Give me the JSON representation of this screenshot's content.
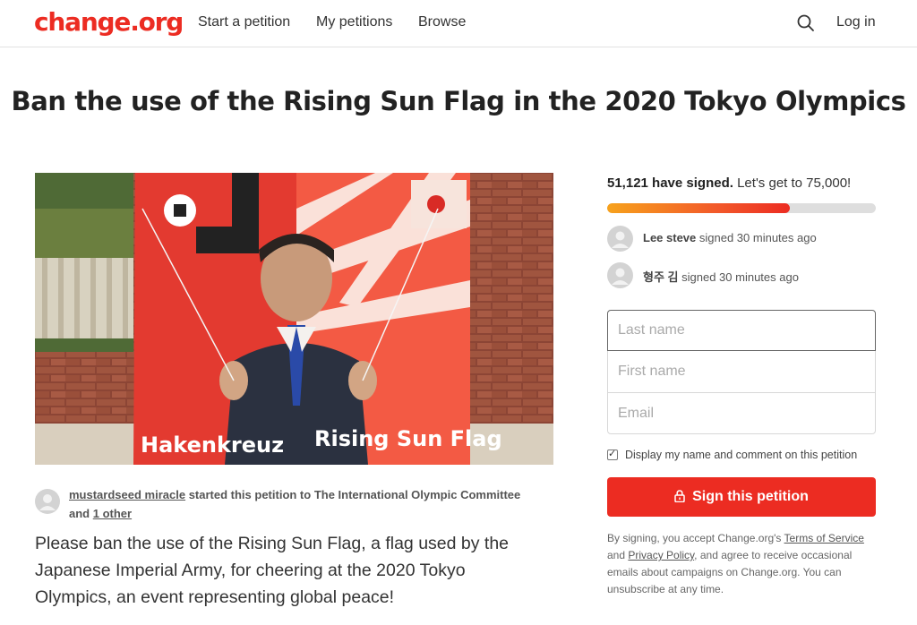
{
  "header": {
    "logo": "change.org",
    "nav": [
      "Start a petition",
      "My petitions",
      "Browse"
    ],
    "login": "Log in"
  },
  "petition": {
    "title": "Ban the use of the Rising Sun Flag in the 2020 Tokyo Olympics",
    "image_caption_left": "Hakenkreuz",
    "image_caption_right": "Rising Sun Flag",
    "starter_name": "mustardseed miracle",
    "starter_text": "started this petition to",
    "recipient": "The International Olympic Committee",
    "and_text": "and",
    "other_recipients": "1 other",
    "description": "Please ban the use of the Rising Sun Flag, a flag used by the Japanese Imperial Army, for cheering at the 2020 Tokyo Olympics, an event representing global peace!"
  },
  "signatures": {
    "count_text": "51,121 have signed.",
    "goal_text": "Let's get to 75,000!",
    "progress_fraction": 0.6816,
    "recent": [
      {
        "name": "Lee steve",
        "action": "signed 30 minutes ago"
      },
      {
        "name": "형주 김",
        "action": "signed 30 minutes ago"
      }
    ]
  },
  "form": {
    "last_name_placeholder": "Last name",
    "first_name_placeholder": "First name",
    "email_placeholder": "Email",
    "display_checkbox_checked": true,
    "display_checkbox_label": "Display my name and comment on this petition",
    "sign_button": "Sign this petition"
  },
  "legal": {
    "p1": "By signing, you accept Change.org's",
    "terms": "Terms of Service",
    "p2": "and",
    "privacy": "Privacy Policy",
    "p3": ", and agree to receive occasional emails about campaigns on Change.org. You can unsubscribe at any time."
  },
  "colors": {
    "brand_red": "#ec2c22",
    "progress_start": "#f7a21c"
  }
}
